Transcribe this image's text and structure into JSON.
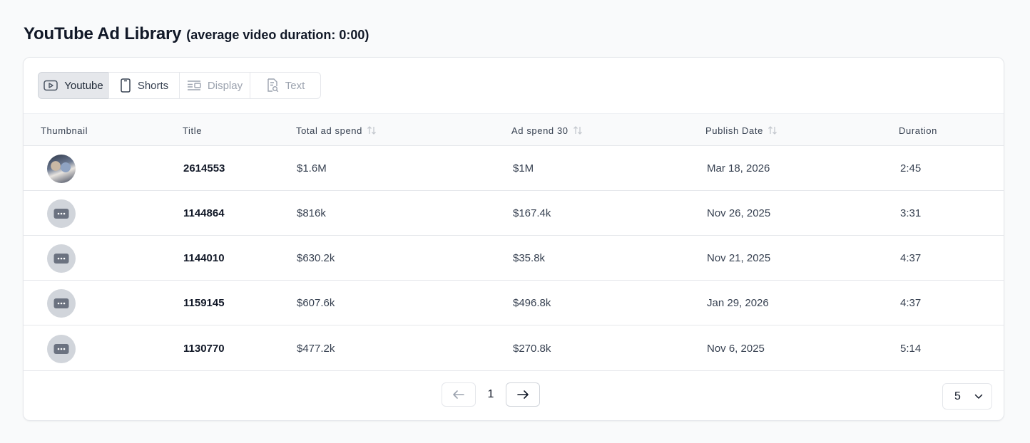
{
  "header": {
    "title": "YouTube Ad Library",
    "subtitle": "(average video duration: 0:00)"
  },
  "tabs": [
    {
      "label": "Youtube",
      "icon": "play-icon",
      "state": "active"
    },
    {
      "label": "Shorts",
      "icon": "phone-icon",
      "state": "normal"
    },
    {
      "label": "Display",
      "icon": "display-icon",
      "state": "disabled"
    },
    {
      "label": "Text",
      "icon": "text-search-icon",
      "state": "disabled"
    }
  ],
  "table": {
    "columns": [
      "Thumbnail",
      "Title",
      "Total ad spend",
      "Ad spend 30",
      "Publish Date",
      "Duration"
    ],
    "rows": [
      {
        "thumbnail": "photo",
        "title": "2614553",
        "total_spend": "$1.6M",
        "spend_30": "$1M",
        "publish_date": "Mar 18, 2026",
        "duration": "2:45"
      },
      {
        "thumbnail": "placeholder",
        "title": "1144864",
        "total_spend": "$816k",
        "spend_30": "$167.4k",
        "publish_date": "Nov 26, 2025",
        "duration": "3:31"
      },
      {
        "thumbnail": "placeholder",
        "title": "1144010",
        "total_spend": "$630.2k",
        "spend_30": "$35.8k",
        "publish_date": "Nov 21, 2025",
        "duration": "4:37"
      },
      {
        "thumbnail": "placeholder",
        "title": "1159145",
        "total_spend": "$607.6k",
        "spend_30": "$496.8k",
        "publish_date": "Jan 29, 2026",
        "duration": "4:37"
      },
      {
        "thumbnail": "placeholder",
        "title": "1130770",
        "total_spend": "$477.2k",
        "spend_30": "$270.8k",
        "publish_date": "Nov 6, 2025",
        "duration": "5:14"
      }
    ]
  },
  "pagination": {
    "current_page": "1",
    "page_size": "5"
  },
  "colors": {
    "accent_active_tab": "#e5e7eb",
    "placeholder_thumb": "#d1d5db",
    "text": "#111827"
  }
}
